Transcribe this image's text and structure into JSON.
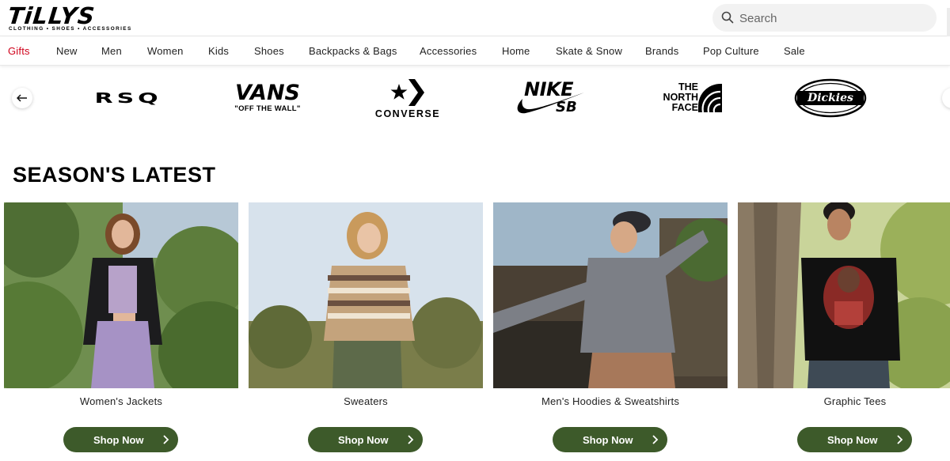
{
  "header": {
    "logo_text": "TiLLYS",
    "logo_tagline": "CLOTHING • SHOES • ACCESSORIES",
    "search_placeholder": "Search"
  },
  "nav": {
    "items": [
      {
        "label": "Gifts",
        "active": true
      },
      {
        "label": "New"
      },
      {
        "label": "Men"
      },
      {
        "label": "Women"
      },
      {
        "label": "Kids"
      },
      {
        "label": "Shoes"
      },
      {
        "label": "Backpacks & Bags"
      },
      {
        "label": "Accessories"
      },
      {
        "label": "Home"
      },
      {
        "label": "Skate & Snow"
      },
      {
        "label": "Brands"
      },
      {
        "label": "Pop Culture"
      },
      {
        "label": "Sale"
      }
    ]
  },
  "brands": {
    "rsq": "RSQ",
    "vans": "VANS",
    "vans_tag": "\"OFF THE WALL\"",
    "converse": "CONVERSE",
    "nike": "NIKE",
    "nike_sb": "SB",
    "tnf_1": "THE",
    "tnf_2": "NORTH",
    "tnf_3": "FACE",
    "dickies": "Dickies"
  },
  "section": {
    "title": "SEASON'S LATEST"
  },
  "cards": [
    {
      "label": "Women's Jackets",
      "cta": "Shop Now"
    },
    {
      "label": "Sweaters",
      "cta": "Shop Now"
    },
    {
      "label": "Men's Hoodies & Sweatshirts",
      "cta": "Shop Now"
    },
    {
      "label": "Graphic Tees",
      "cta": "Shop Now"
    }
  ],
  "colors": {
    "accent_red": "#d0021b",
    "button_green": "#3d5a2a"
  }
}
